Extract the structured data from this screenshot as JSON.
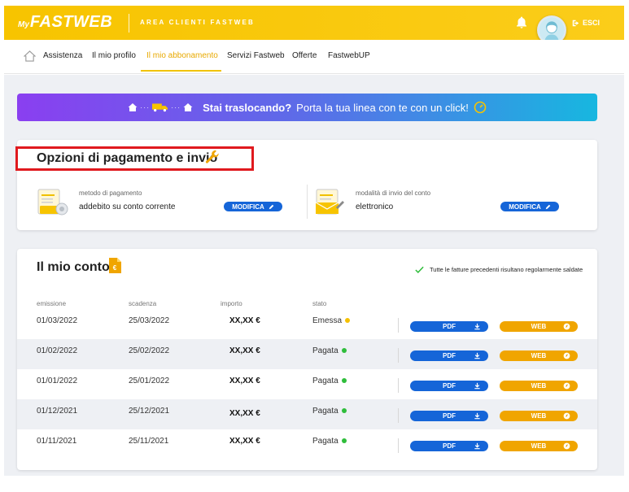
{
  "header": {
    "logo_my": "My",
    "logo_brand": "FASTWEB",
    "area_title": "AREA CLIENTI FASTWEB",
    "logout_label": "ESCI"
  },
  "nav": {
    "items": [
      {
        "label": "Assistenza"
      },
      {
        "label": "Il mio profilo"
      },
      {
        "label": "Il mio abbonamento",
        "active": true
      },
      {
        "label": "Servizi Fastweb"
      },
      {
        "label": "Offerte"
      },
      {
        "label": "FastwebUP"
      }
    ]
  },
  "banner": {
    "bold_text": "Stai traslocando?",
    "text": "Porta la tua linea con te con un click!"
  },
  "payment": {
    "title": "Opzioni di pagamento e invio",
    "method_label": "metodo di pagamento",
    "method_value": "addebito su conto corrente",
    "delivery_label": "modalità di invio del conto",
    "delivery_value": "elettronico",
    "edit_label": "MODIFICA"
  },
  "account": {
    "title": "Il mio conto",
    "status_note": "Tutte le fatture precedenti risultano regolarmente saldate",
    "columns": [
      "emissione",
      "scadenza",
      "importo",
      "stato"
    ],
    "pdf_label": "PDF",
    "web_label": "WEB",
    "rows": [
      {
        "emissione": "01/03/2022",
        "scadenza": "25/03/2022",
        "importo": "XX,XX €",
        "stato": "Emessa",
        "status_color": "#f5c000"
      },
      {
        "emissione": "01/02/2022",
        "scadenza": "25/02/2022",
        "importo": "XX,XX €",
        "stato": "Pagata",
        "status_color": "#2fbd3b"
      },
      {
        "emissione": "01/01/2022",
        "scadenza": "25/01/2022",
        "importo": "XX,XX €",
        "stato": "Pagata",
        "status_color": "#2fbd3b"
      },
      {
        "emissione": "01/12/2021",
        "scadenza": "25/12/2021",
        "importo": "XX,XX €",
        "stato": "Pagata",
        "status_color": "#2fbd3b"
      },
      {
        "emissione": "01/11/2021",
        "scadenza": "25/11/2021",
        "importo": "XX,XX €",
        "stato": "Pagata",
        "status_color": "#2fbd3b"
      }
    ]
  },
  "colors": {
    "brand_yellow": "#f7c400",
    "primary_blue": "#1565d8",
    "web_orange": "#f0a500",
    "highlight_red": "#e0191e"
  }
}
